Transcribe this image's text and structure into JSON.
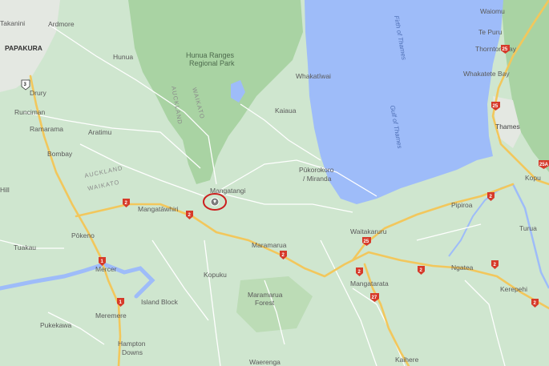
{
  "map": {
    "colors": {
      "land": "#cfe6cf",
      "forest": "#a9d3a3",
      "water": "#9ebcf9",
      "highway": "#f2c75c",
      "road": "#ffffff",
      "urban": "#e8e8e8",
      "river": "#9ebcf9",
      "marker": "#cc1f1f"
    },
    "water_labels": {
      "firth": "Firth of Thames",
      "gulf": "Gulf of Thames"
    },
    "park": {
      "line1": "Hunua Ranges",
      "line2": "Regional Park"
    },
    "regions": {
      "auckland_vertical": "AUCKLAND",
      "waikato_vertical": "WAIKATO",
      "auckland_horizontal": "AUCKLAND",
      "waikato_horizontal": "WAIKATO"
    },
    "places": {
      "takanini": "Takanini",
      "papakura": "PAPAKURA",
      "ardmore": "Ardmore",
      "hunua": "Hunua",
      "drury": "Drury",
      "runciman": "Runciman",
      "ramarama": "Ramarama",
      "aratimu": "Aratimu",
      "bombay": "Bombay",
      "hill": "Hill",
      "mangatawhiri": "Mangatāwhiri",
      "mangatangi": "Mangatangi",
      "pokeno": "Pōkeno",
      "tuakau": "Tuakau",
      "mercer": "Mercer",
      "island_block": "Island Block",
      "meremere": "Meremere",
      "pukekawa": "Pukekawa",
      "hampton_downs_1": "Hampton",
      "hampton_downs_2": "Downs",
      "kopuku": "Kopuku",
      "maramarua": "Maramarua",
      "maramarua_forest_1": "Maramarua",
      "maramarua_forest_2": "Forest",
      "waerenga": "Waerenga",
      "kaiaua": "Kaiaua",
      "whakatiwai": "Whakatīwai",
      "pukorokoro_1": "Pūkorokoro",
      "pukorokoro_2": "/ Miranda",
      "waitakaruru": "Waitakaruru",
      "pipiroa": "Pipiroa",
      "mangatarata": "Mangatarata",
      "ngatea": "Ngatea",
      "kerepehi": "Kerepehi",
      "kaihere": "Kaihere",
      "waiomu": "Waiomu",
      "te_puru": "Te Puru",
      "thornton_bay": "Thornton Bay",
      "whakatete_bay": "Whakatete Bay",
      "thames": "Thames",
      "kopu": "Kopu",
      "turua": "Turua"
    },
    "shields": {
      "sh1_a": "1",
      "sh1_b": "1",
      "sh2_a": "2",
      "sh2_b": "2",
      "sh2_c": "2",
      "sh2_d": "2",
      "sh2_e": "2",
      "sh2_f": "2",
      "sh2_g": "2",
      "sh2_h": "2",
      "sh3": "3",
      "sh25_a": "25",
      "sh25_b": "25",
      "sh25_c": "25",
      "sh25a": "25A",
      "sh27": "27"
    }
  }
}
